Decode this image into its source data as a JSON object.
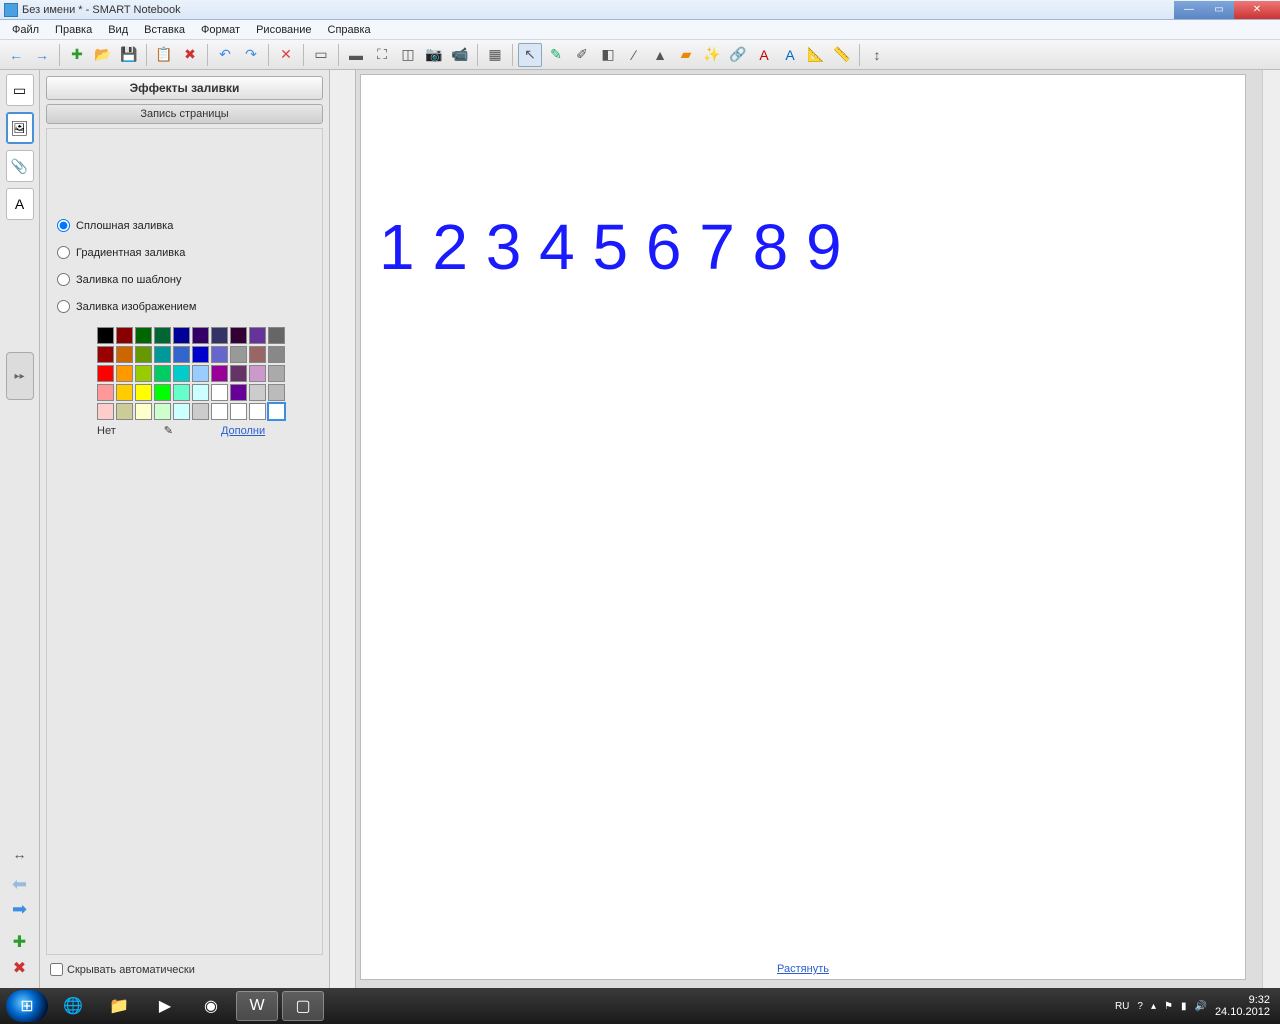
{
  "window": {
    "title": "Без имени * - SMART Notebook"
  },
  "menu": {
    "items": [
      "Файл",
      "Правка",
      "Вид",
      "Вставка",
      "Формат",
      "Рисование",
      "Справка"
    ]
  },
  "toolbar": {
    "items": [
      {
        "name": "nav-back-icon",
        "glyph": "←",
        "color": "#3a8ee6"
      },
      {
        "name": "nav-fwd-icon",
        "glyph": "→",
        "color": "#3a8ee6"
      },
      {
        "sep": true
      },
      {
        "name": "add-page-icon",
        "glyph": "✚",
        "color": "#2a9d2a"
      },
      {
        "name": "open-icon",
        "glyph": "📂"
      },
      {
        "name": "save-icon",
        "glyph": "💾"
      },
      {
        "sep": true
      },
      {
        "name": "paste-icon",
        "glyph": "📋"
      },
      {
        "name": "delete-icon",
        "glyph": "✖",
        "color": "#c33"
      },
      {
        "sep": true
      },
      {
        "name": "undo-icon",
        "glyph": "↶",
        "color": "#3a8ee6"
      },
      {
        "name": "redo-icon",
        "glyph": "↷",
        "color": "#3a8ee6"
      },
      {
        "sep": true
      },
      {
        "name": "remove-icon",
        "glyph": "✕",
        "color": "#d44"
      },
      {
        "sep": true
      },
      {
        "name": "show-hide-icon",
        "glyph": "▭"
      },
      {
        "sep": true
      },
      {
        "name": "screen-shade-icon",
        "glyph": "▬"
      },
      {
        "name": "fullscreen-icon",
        "glyph": "⛶"
      },
      {
        "name": "dual-page-icon",
        "glyph": "◫"
      },
      {
        "name": "capture-icon",
        "glyph": "📷"
      },
      {
        "name": "doc-camera-icon",
        "glyph": "📹"
      },
      {
        "sep": true
      },
      {
        "name": "table-icon",
        "glyph": "▦"
      },
      {
        "sep": true
      },
      {
        "name": "select-icon",
        "glyph": "↖",
        "sel": true
      },
      {
        "name": "pen-icon",
        "glyph": "✎",
        "color": "#1a6"
      },
      {
        "name": "creative-pen-icon",
        "glyph": "✐"
      },
      {
        "name": "eraser-icon",
        "glyph": "◧"
      },
      {
        "name": "line-icon",
        "glyph": "∕"
      },
      {
        "name": "shapes-icon",
        "glyph": "▲"
      },
      {
        "name": "fill-icon",
        "glyph": "▰",
        "color": "#e80"
      },
      {
        "name": "magic-pen-icon",
        "glyph": "✨"
      },
      {
        "name": "link-icon",
        "glyph": "🔗"
      },
      {
        "name": "text-icon",
        "glyph": "A",
        "color": "#c00"
      },
      {
        "name": "text-style-icon",
        "glyph": "A",
        "color": "#06c"
      },
      {
        "name": "measure-icon",
        "glyph": "📐"
      },
      {
        "name": "ruler-icon",
        "glyph": "📏"
      },
      {
        "sep": true
      },
      {
        "name": "move-toolbar-icon",
        "glyph": "↕"
      }
    ]
  },
  "lefttabs": {
    "items": [
      {
        "name": "page-sorter-tab",
        "glyph": "▭"
      },
      {
        "name": "gallery-tab",
        "glyph": "🖼",
        "active": true
      },
      {
        "name": "attachments-tab",
        "glyph": "📎"
      },
      {
        "name": "properties-tab",
        "glyph": "A"
      }
    ],
    "collapse": "▸▸"
  },
  "sidepanel": {
    "header": "Эффекты заливки",
    "subheader": "Запись страницы",
    "fill_options": [
      {
        "id": "solid",
        "label": "Сплошная заливка",
        "checked": true
      },
      {
        "id": "gradient",
        "label": "Градиентная заливка",
        "checked": false
      },
      {
        "id": "pattern",
        "label": "Заливка по шаблону",
        "checked": false
      },
      {
        "id": "image",
        "label": "Заливка изображением",
        "checked": false
      }
    ],
    "swatch_rows": [
      [
        "#000",
        "#800",
        "#060",
        "#063",
        "#009",
        "#306",
        "#336",
        "#303",
        "#639",
        "#666"
      ],
      [
        "#900",
        "#c60",
        "#690",
        "#099",
        "#36c",
        "#00c",
        "#66c",
        "#999",
        "#966",
        "#888"
      ],
      [
        "#f00",
        "#f90",
        "#9c0",
        "#0c6",
        "#0cc",
        "#9cf",
        "#909",
        "#636",
        "#c9c",
        "#aaa"
      ],
      [
        "#f99",
        "#fc0",
        "#ff0",
        "#0f0",
        "#6fc",
        "#cff",
        "#fff",
        "#609",
        "#ccc",
        "#bbb"
      ],
      [
        "#fcc",
        "#cc9",
        "#ffc",
        "#cfc",
        "#cff",
        "#ccc",
        "#fff",
        "#fff",
        "#fff",
        "#fff"
      ]
    ],
    "selected_swatch": "4,9",
    "none_label": "Нет",
    "more_link": "Дополни",
    "autohide_label": "Скрывать автоматически"
  },
  "canvas": {
    "text": "1 2 3 4 5 6 7 8 9",
    "stretch_link": "Растянуть"
  },
  "taskbar": {
    "lang": "RU",
    "time": "9:32",
    "date": "24.10.2012"
  }
}
